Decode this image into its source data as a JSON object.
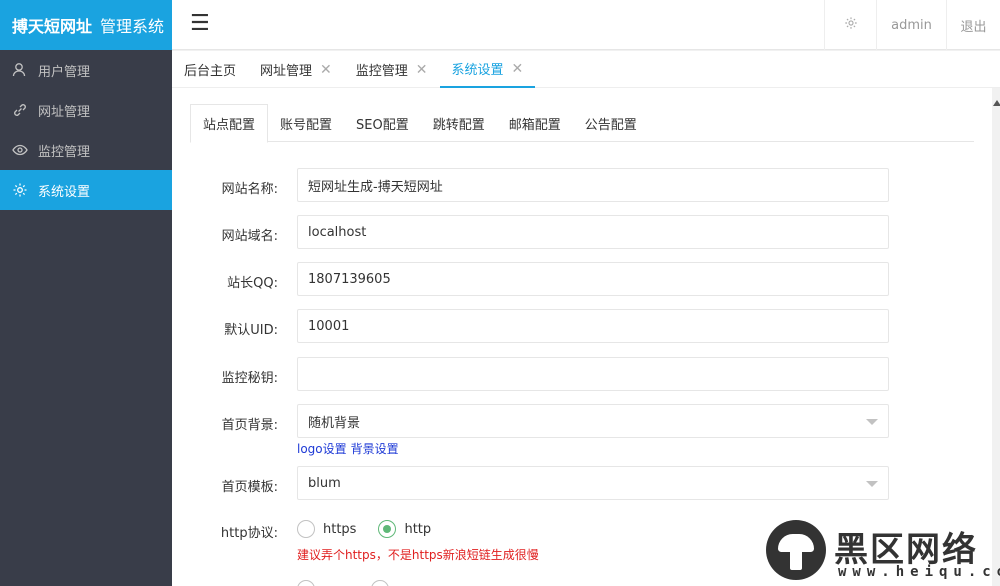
{
  "brand": {
    "bold": "搏天短网址",
    "rest": "管理系统"
  },
  "sidebar": {
    "items": [
      {
        "label": "用户管理",
        "icon": "user-icon"
      },
      {
        "label": "网址管理",
        "icon": "link-icon"
      },
      {
        "label": "监控管理",
        "icon": "eye-icon"
      },
      {
        "label": "系统设置",
        "icon": "gear-icon",
        "active": true
      }
    ]
  },
  "header": {
    "menu_icon": "☰",
    "user": "admin",
    "logout": "退出"
  },
  "page_tabs": [
    {
      "label": "后台主页"
    },
    {
      "label": "网址管理"
    },
    {
      "label": "监控管理"
    },
    {
      "label": "系统设置",
      "active": true
    }
  ],
  "tab_close": "✕",
  "inner_tabs": [
    "站点配置",
    "账号配置",
    "SEO配置",
    "跳转配置",
    "邮箱配置",
    "公告配置"
  ],
  "form": {
    "site_name": {
      "label": "网站名称:",
      "value": "短网址生成-搏天短网址"
    },
    "site_domain": {
      "label": "网站域名:",
      "value": "localhost"
    },
    "admin_qq": {
      "label": "站长QQ:",
      "value": "1807139605"
    },
    "default_uid": {
      "label": "默认UID:",
      "value": "10001"
    },
    "monitor_key": {
      "label": "监控秘钥:",
      "value": ""
    },
    "home_bg": {
      "label": "首页背景:",
      "value": "随机背景"
    },
    "links": {
      "logo": "logo设置",
      "bg": "背景设置"
    },
    "home_template": {
      "label": "首页模板:",
      "value": "blum"
    },
    "http_protocol": {
      "label": "http协议:",
      "options": [
        "https",
        "http"
      ],
      "selected": "http"
    },
    "warning": "建议弄个https，不是https新浪短链生成很慢"
  },
  "watermark": {
    "text": "黑区网络",
    "sub": "www.heiqu.com"
  },
  "colors": {
    "accent": "#1aa3e0",
    "sidebar": "#393d49",
    "radio_on": "#5fb878",
    "warning": "#e02020",
    "link": "#1e3ad6"
  }
}
